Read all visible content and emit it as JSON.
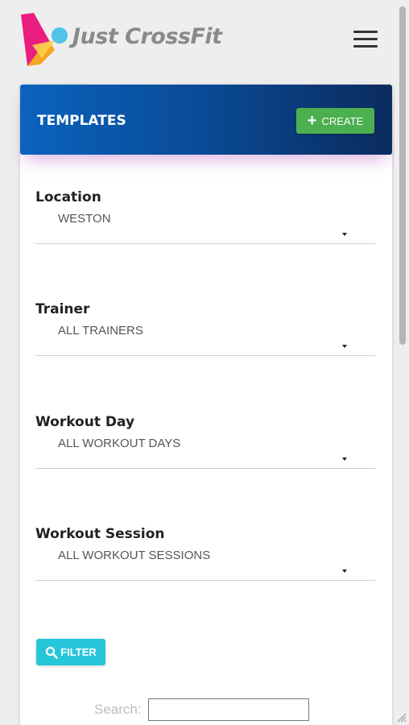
{
  "header": {
    "brand": "Just CrossFit",
    "logo_icon": "just-crossfit-logo",
    "menu_icon": "hamburger-icon"
  },
  "card": {
    "title": "TEMPLATES",
    "create_label": "CREATE",
    "create_icon": "plus-icon"
  },
  "filters": {
    "location": {
      "label": "Location",
      "value": "WESTON"
    },
    "trainer": {
      "label": "Trainer",
      "value": "ALL TRAINERS"
    },
    "workout_day": {
      "label": "Workout Day",
      "value": "ALL WORKOUT DAYS"
    },
    "workout_session": {
      "label": "Workout Session",
      "value": "ALL WORKOUT SESSIONS"
    },
    "filter_label": "FILTER",
    "filter_icon": "search-icon"
  },
  "search": {
    "label": "Search:",
    "value": ""
  },
  "colors": {
    "header_gradient_start": "#0a63be",
    "header_gradient_end": "#0b2b5e",
    "create_button": "#4caf50",
    "filter_button": "#26c6da"
  }
}
